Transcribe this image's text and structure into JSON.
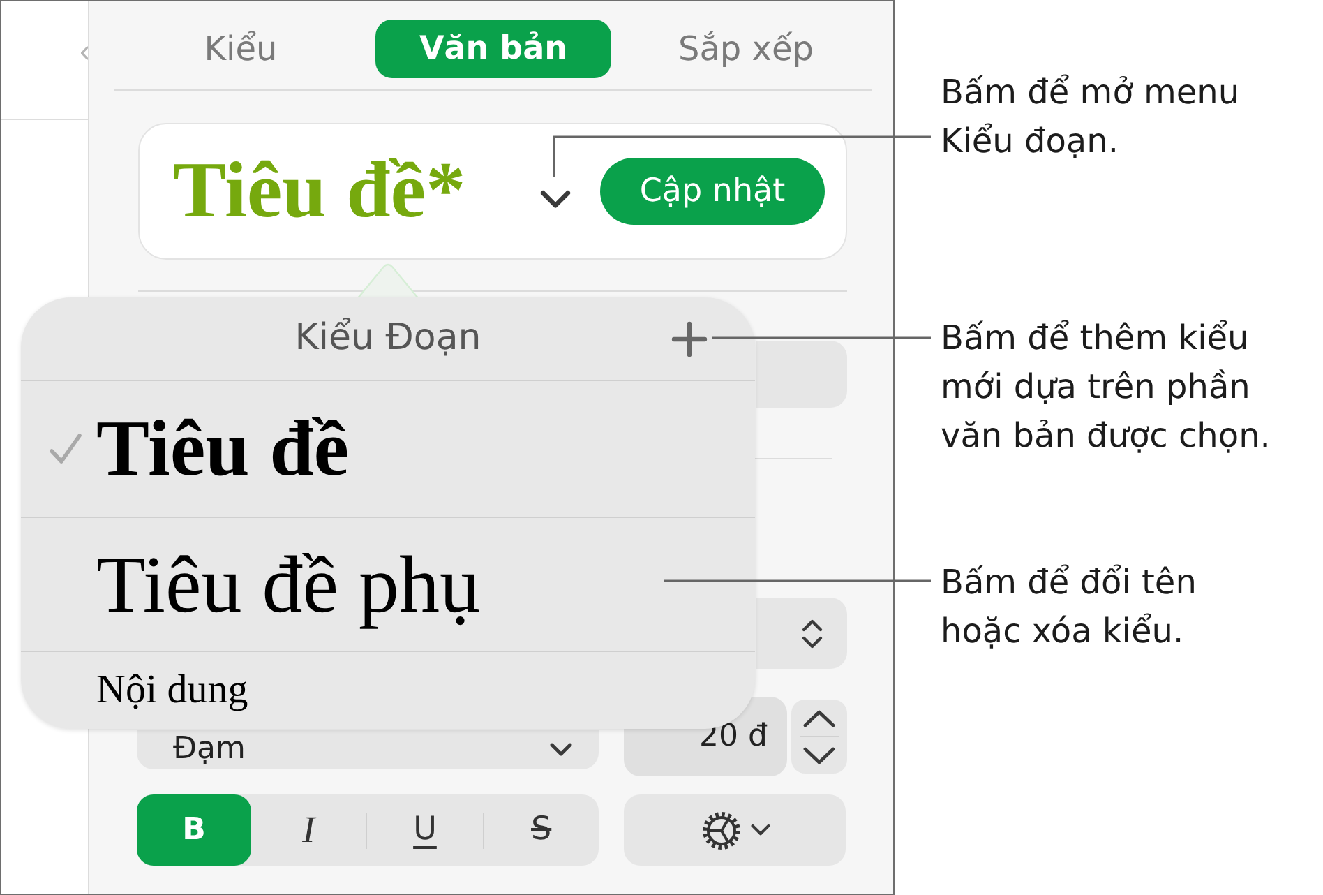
{
  "inspector": {
    "tabs": [
      {
        "label": "Kiểu",
        "selected": false
      },
      {
        "label": "Văn bản",
        "selected": true
      },
      {
        "label": "Sắp xếp",
        "selected": false
      }
    ],
    "paragraph_style": {
      "name": "Tiêu đề*",
      "update_button": "Cập nhật"
    },
    "font": {
      "typeface_style": "Đạm",
      "size": "20 đ"
    },
    "format_buttons": [
      {
        "kind": "bold",
        "label": "B",
        "selected": true
      },
      {
        "kind": "italic",
        "label": "I",
        "selected": false
      },
      {
        "kind": "underline",
        "label": "U",
        "selected": false
      },
      {
        "kind": "strikethrough",
        "label": "S",
        "selected": false
      }
    ]
  },
  "style_menu": {
    "title": "Kiểu Đoạn",
    "items": [
      {
        "kind": "title",
        "label": "Tiêu đề",
        "selected": true
      },
      {
        "kind": "subtitle",
        "label": "Tiêu đề phụ",
        "selected": false
      },
      {
        "kind": "body",
        "label": "Nội dung",
        "selected": false
      }
    ]
  },
  "callouts": [
    {
      "lines": [
        "Bấm để mở menu",
        "Kiểu đoạn."
      ]
    },
    {
      "lines": [
        "Bấm để thêm kiểu",
        "mới dựa trên phần",
        "văn bản được chọn."
      ]
    },
    {
      "lines": [
        "Bấm để đổi tên",
        "hoặc xóa kiểu."
      ]
    }
  ]
}
